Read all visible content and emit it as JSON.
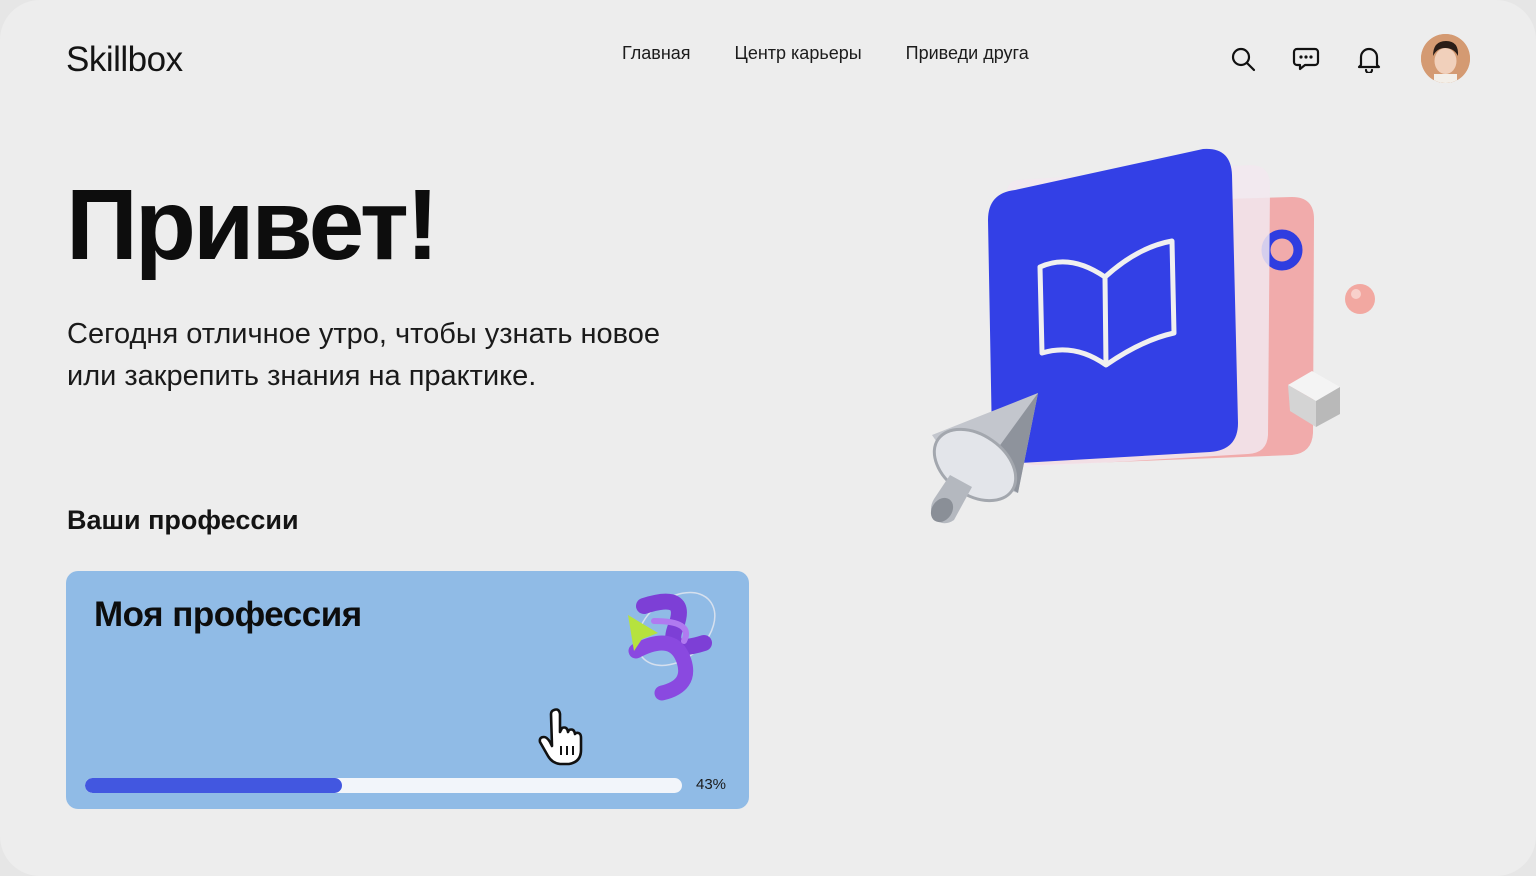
{
  "header": {
    "logo": "Skillbox",
    "nav": [
      {
        "label": "Главная"
      },
      {
        "label": "Центр карьеры"
      },
      {
        "label": "Приведи друга"
      }
    ],
    "icons": [
      "search-icon",
      "chat-icon",
      "bell-icon"
    ]
  },
  "main": {
    "greeting": "Привет!",
    "subtitle": "Сегодня отличное утро, чтобы узнать новое или закрепить знания на практике.",
    "section_title": "Ваши профессии"
  },
  "profession_card": {
    "title": "Моя профессия",
    "progress_percent": 43,
    "progress_label": "43%"
  },
  "colors": {
    "background": "#ededed",
    "card": "#90bbe6",
    "progress_fill": "#4257e0",
    "hero_blue": "#3340e6",
    "hero_pink": "#f2a6a6"
  }
}
